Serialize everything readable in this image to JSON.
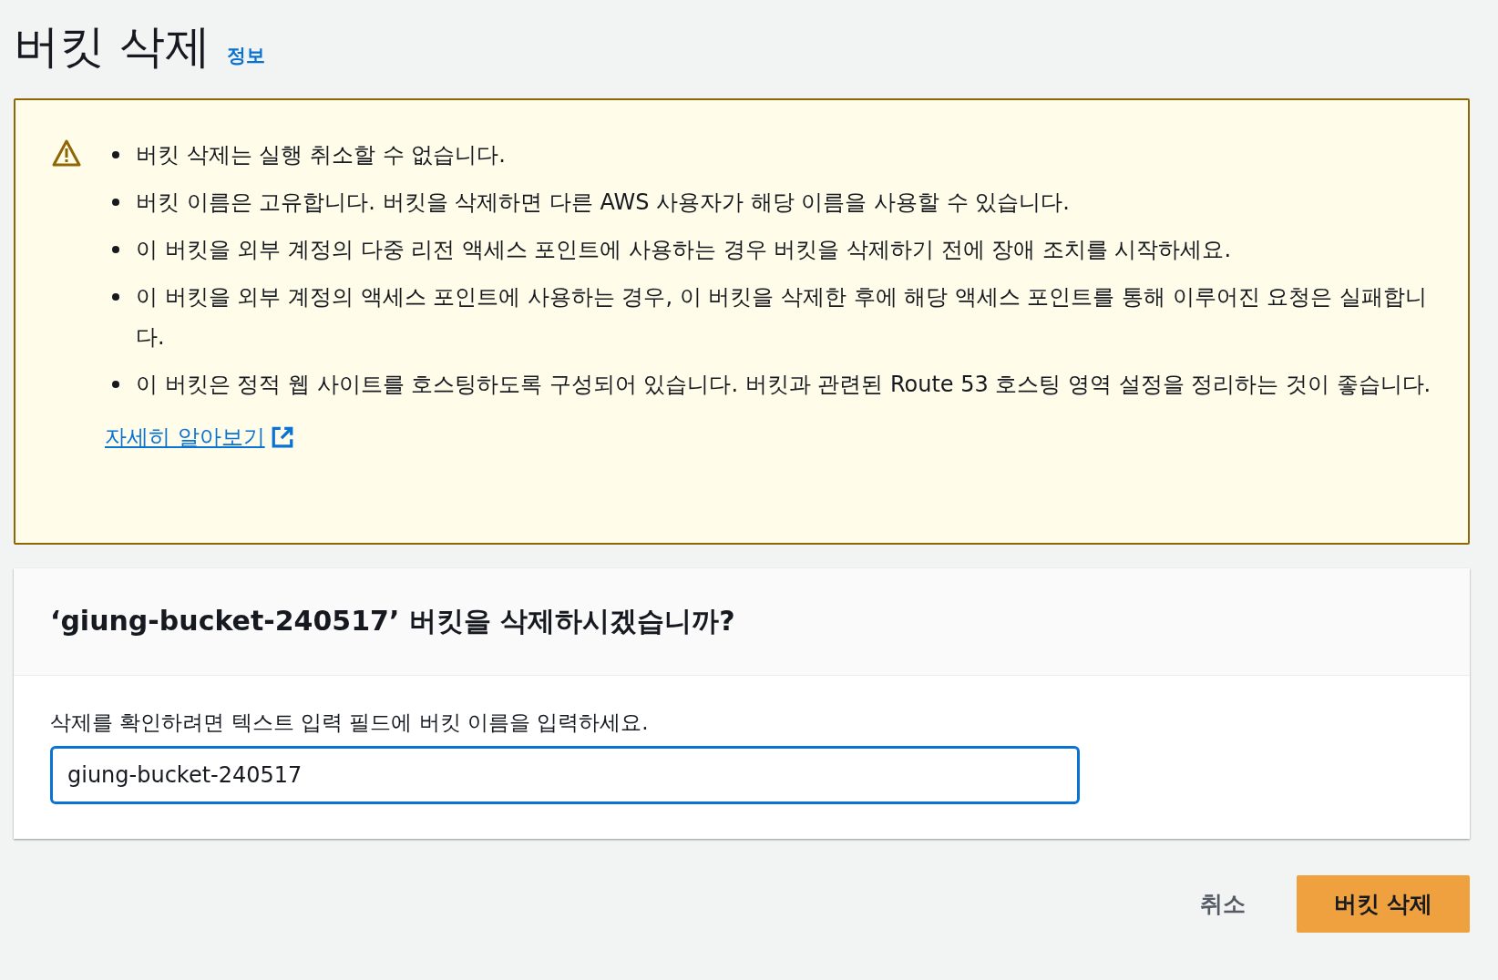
{
  "page": {
    "title": "버킷 삭제",
    "info_link": "정보"
  },
  "warning": {
    "items": [
      "버킷 삭제는 실행 취소할 수 없습니다.",
      "버킷 이름은 고유합니다. 버킷을 삭제하면 다른 AWS 사용자가 해당 이름을 사용할 수 있습니다.",
      "이 버킷을 외부 계정의 다중 리전 액세스 포인트에 사용하는 경우 버킷을 삭제하기 전에 장애 조치를 시작하세요.",
      "이 버킷을 외부 계정의 액세스 포인트에 사용하는 경우, 이 버킷을 삭제한 후에 해당 액세스 포인트를 통해 이루어진 요청은 실패합니다.",
      "이 버킷은 정적 웹 사이트를 호스팅하도록 구성되어 있습니다. 버킷과 관련된 Route 53 호스팅 영역 설정을 정리하는 것이 좋습니다."
    ],
    "learn_more": "자세히 알아보기"
  },
  "confirm": {
    "heading": "‘giung-bucket-240517’ 버킷을 삭제하시겠습니까?",
    "label": "삭제를 확인하려면 텍스트 입력 필드에 버킷 이름을 입력하세요.",
    "value": "giung-bucket-240517"
  },
  "buttons": [
    {
      "kind": "link",
      "label": "취소"
    },
    {
      "kind": "primary",
      "label": "버킷 삭제"
    }
  ]
}
